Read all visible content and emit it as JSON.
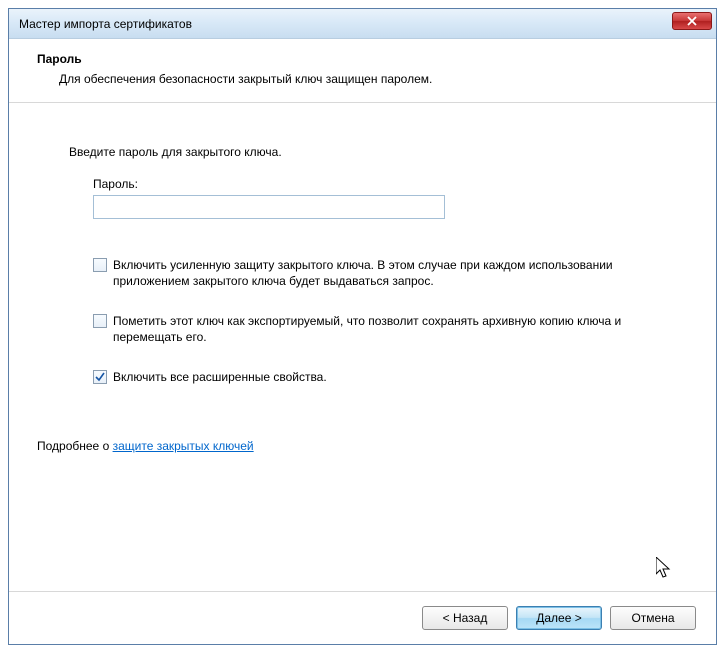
{
  "window": {
    "title": "Мастер импорта сертификатов"
  },
  "section": {
    "title": "Пароль",
    "description": "Для обеспечения безопасности закрытый ключ защищен паролем."
  },
  "prompt": "Введите пароль для закрытого ключа.",
  "passwordField": {
    "label": "Пароль:",
    "value": ""
  },
  "options": {
    "strongProtection": {
      "checked": false,
      "label": "Включить усиленную защиту закрытого ключа. В этом случае при каждом использовании приложением закрытого ключа будет выдаваться запрос."
    },
    "exportable": {
      "checked": false,
      "label": "Пометить этот ключ как экспортируемый, что позволит сохранять архивную копию ключа и перемещать его."
    },
    "extendedProps": {
      "checked": true,
      "label": "Включить все расширенные свойства."
    }
  },
  "learnMore": {
    "prefix": "Подробнее о ",
    "link": "защите закрытых ключей"
  },
  "buttons": {
    "back": "< Назад",
    "next": "Далее >",
    "cancel": "Отмена"
  }
}
